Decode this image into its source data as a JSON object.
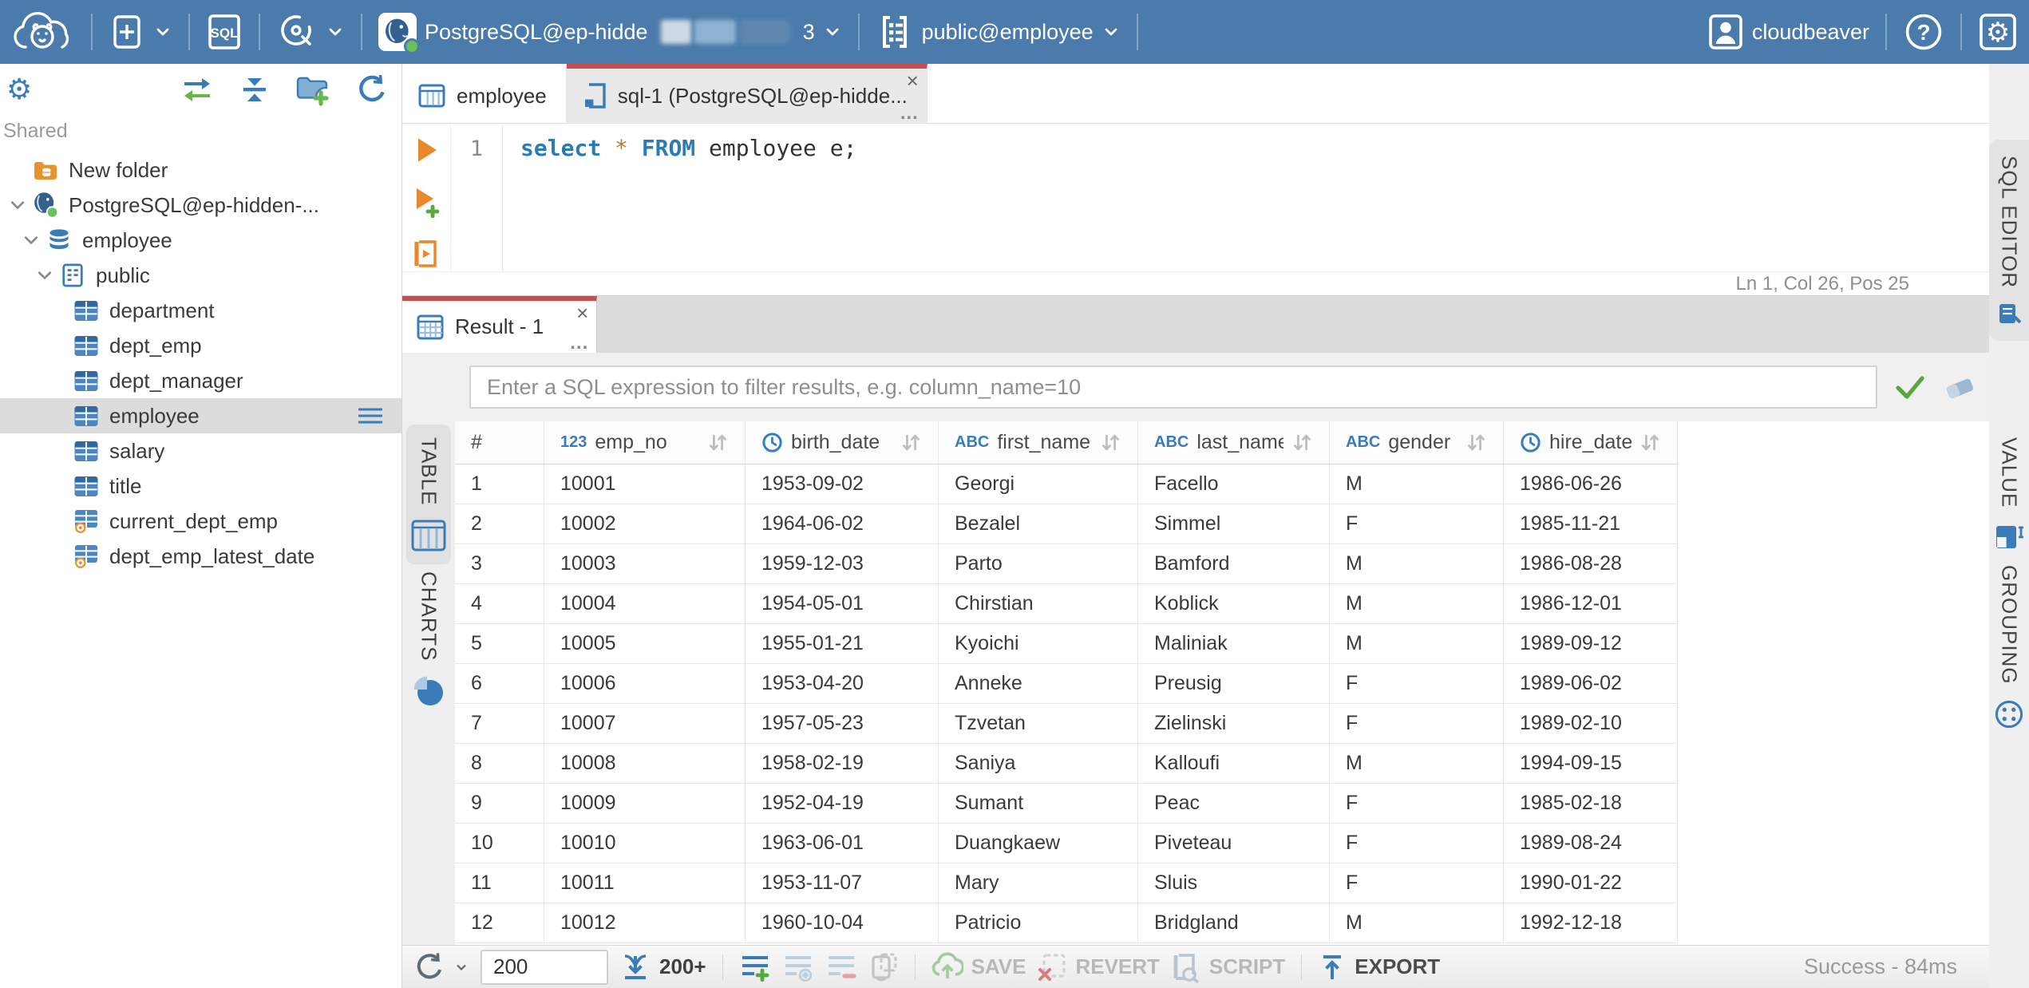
{
  "colors": {
    "topbar_bg": "#4b7bab",
    "tab_accent": "#c65050",
    "icon_blue": "#3a7cb8",
    "folder_orange": "#e8912f",
    "run_orange": "#e8872b",
    "success_green": "#56a83c",
    "selected_row_bg": "#dcdcdc"
  },
  "topbar": {
    "icons": [
      "cloudbeaver-logo",
      "new-object",
      "sql-editor-button",
      "driver-manager",
      "postgres-connection",
      "schema-selector",
      "user",
      "help",
      "settings"
    ],
    "sql_badge": "SQL",
    "connection": {
      "visible_text": "PostgreSQL@ep-hidde",
      "masked": true,
      "tail": "3"
    },
    "schema_selector": "public@employee",
    "account_label": "cloudbeaver"
  },
  "sidebar": {
    "header_icons": [
      "gear",
      "sync-connection",
      "collapse-all",
      "new-folder",
      "refresh"
    ],
    "section_label": "Shared",
    "tree": [
      {
        "label": "New folder",
        "icon": "folder-db",
        "indent": 0
      },
      {
        "label": "PostgreSQL@ep-hidden-...",
        "icon": "postgres",
        "indent": 0,
        "expanded": true
      },
      {
        "label": "employee",
        "icon": "database",
        "indent": 1,
        "expanded": true
      },
      {
        "label": "public",
        "icon": "schema",
        "indent": 2,
        "expanded": true
      },
      {
        "label": "department",
        "icon": "table",
        "indent": 3
      },
      {
        "label": "dept_emp",
        "icon": "table",
        "indent": 3
      },
      {
        "label": "dept_manager",
        "icon": "table",
        "indent": 3
      },
      {
        "label": "employee",
        "icon": "table",
        "indent": 3,
        "selected": true
      },
      {
        "label": "salary",
        "icon": "table",
        "indent": 3
      },
      {
        "label": "title",
        "icon": "table",
        "indent": 3
      },
      {
        "label": "current_dept_emp",
        "icon": "view",
        "indent": 3
      },
      {
        "label": "dept_emp_latest_date",
        "icon": "view",
        "indent": 3
      }
    ]
  },
  "editor": {
    "tabs": [
      {
        "label": "employee",
        "icon": "table",
        "active": false
      },
      {
        "label": "sql-1 (PostgreSQL@ep-hidde...",
        "icon": "sql-script",
        "active": true
      }
    ],
    "line_number": "1",
    "tokens": [
      {
        "text": "select",
        "cls": "kw"
      },
      {
        "text": " ",
        "cls": "plain"
      },
      {
        "text": "*",
        "cls": "star"
      },
      {
        "text": " ",
        "cls": "plain"
      },
      {
        "text": "FROM",
        "cls": "kw"
      },
      {
        "text": " employee e;",
        "cls": "plain"
      }
    ],
    "status": "Ln 1, Col 26, Pos 25",
    "side_tab": "SQL EDITOR"
  },
  "result": {
    "tab_label": "Result - 1",
    "filter_placeholder": "Enter a SQL expression to filter results, e.g. column_name=10",
    "left_tabs": [
      {
        "label": "TABLE",
        "active": true
      },
      {
        "label": "CHARTS",
        "active": false
      }
    ],
    "right_tabs": [
      {
        "label": "VALUE"
      },
      {
        "label": "GROUPING"
      }
    ],
    "grid": {
      "columns": [
        {
          "name": "#",
          "type": null
        },
        {
          "name": "emp_no",
          "type": "number"
        },
        {
          "name": "birth_date",
          "type": "date"
        },
        {
          "name": "first_name",
          "type": "string"
        },
        {
          "name": "last_name",
          "type": "string"
        },
        {
          "name": "gender",
          "type": "string"
        },
        {
          "name": "hire_date",
          "type": "date"
        }
      ],
      "rows": [
        [
          "1",
          "10001",
          "1953-09-02",
          "Georgi",
          "Facello",
          "M",
          "1986-06-26"
        ],
        [
          "2",
          "10002",
          "1964-06-02",
          "Bezalel",
          "Simmel",
          "F",
          "1985-11-21"
        ],
        [
          "3",
          "10003",
          "1959-12-03",
          "Parto",
          "Bamford",
          "M",
          "1986-08-28"
        ],
        [
          "4",
          "10004",
          "1954-05-01",
          "Chirstian",
          "Koblick",
          "M",
          "1986-12-01"
        ],
        [
          "5",
          "10005",
          "1955-01-21",
          "Kyoichi",
          "Maliniak",
          "M",
          "1989-09-12"
        ],
        [
          "6",
          "10006",
          "1953-04-20",
          "Anneke",
          "Preusig",
          "F",
          "1989-06-02"
        ],
        [
          "7",
          "10007",
          "1957-05-23",
          "Tzvetan",
          "Zielinski",
          "F",
          "1989-02-10"
        ],
        [
          "8",
          "10008",
          "1958-02-19",
          "Saniya",
          "Kalloufi",
          "M",
          "1994-09-15"
        ],
        [
          "9",
          "10009",
          "1952-04-19",
          "Sumant",
          "Peac",
          "F",
          "1985-02-18"
        ],
        [
          "10",
          "10010",
          "1963-06-01",
          "Duangkaew",
          "Piveteau",
          "F",
          "1989-08-24"
        ],
        [
          "11",
          "10011",
          "1953-11-07",
          "Mary",
          "Sluis",
          "F",
          "1990-01-22"
        ],
        [
          "12",
          "10012",
          "1960-10-04",
          "Patricio",
          "Bridgland",
          "M",
          "1992-12-18"
        ]
      ]
    },
    "toolbar": {
      "row_limit": "200",
      "fetch_label": "200+",
      "save_label": "SAVE",
      "revert_label": "REVERT",
      "script_label": "SCRIPT",
      "export_label": "EXPORT",
      "status": "Success - 84ms"
    }
  }
}
